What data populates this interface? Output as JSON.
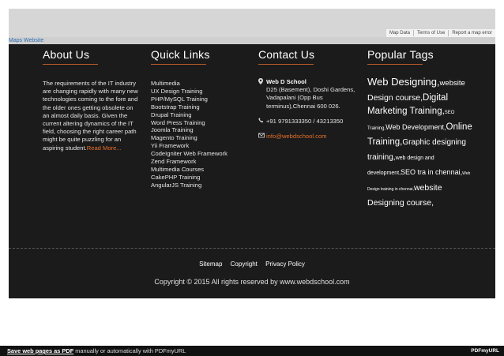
{
  "map": {
    "attribution": [
      "Map Data",
      "Terms of Use",
      "Report a map error"
    ],
    "maps_website": "Maps Website"
  },
  "about": {
    "title": "About Us",
    "text": "The requirements of the IT industry are changing rapidly with many new technologies coming to the fore and the older ones getting obsolete on an almost daily basis. Given the current altering dynamics of the IT field, choosing the right career path might be quite puzzling for an aspiring student.",
    "read_more": "Read More..."
  },
  "quick_links": {
    "title": "Quick Links",
    "items": [
      "Multimedia",
      "UX Design Training",
      "PHP/MySQL Training",
      "Bootstrap Training",
      "Drupal Training",
      "Word Press Training",
      "Joomla Training",
      "Magento Training",
      "Yii Framework",
      "CodeIgniter Web Framework",
      "Zend Framework",
      "Multimedia Courses",
      "CakePHP Training",
      "AngularJS Training"
    ]
  },
  "contact": {
    "title": "Contact Us",
    "name": "Web D School",
    "address": "D25 (Basement), Doshi Gardens, Vadapalani (Opp Bus terminus),Chennai 600 026.",
    "phone": "+91 9791333350 / 43213350",
    "email": "info@webdschool.com",
    "icons": [
      "map-marker-icon",
      "phone-icon",
      "envelope-icon"
    ]
  },
  "tags": {
    "title": "Popular Tags",
    "t1": "Web Designing,",
    "t2": "website",
    "t3": "Design course,",
    "t4": "Digital Marketing Training,",
    "t5": "SEO Training,",
    "t6": "Web Development,",
    "t7": "Online Training,",
    "t8": "Graphic designing training,",
    "t9": "web design and development,",
    "t10": "SEO tra in chennai,",
    "t11": "Web Design training in chennai,",
    "t12": "website Designing course,"
  },
  "footer_links": [
    "Sitemap",
    "Copyright",
    "Privacy Policy"
  ],
  "copyright": "Copyright © 2015 All rights reserved by www.webdschool.com",
  "bottom_bar": {
    "save_link": "Save web pages as PDF",
    "rest": " manually or automatically with PDFmyURL",
    "logo": "PDFmyURL"
  },
  "colors": {
    "accent": "#e8702a",
    "footer_bg": "#1b1b1b"
  }
}
